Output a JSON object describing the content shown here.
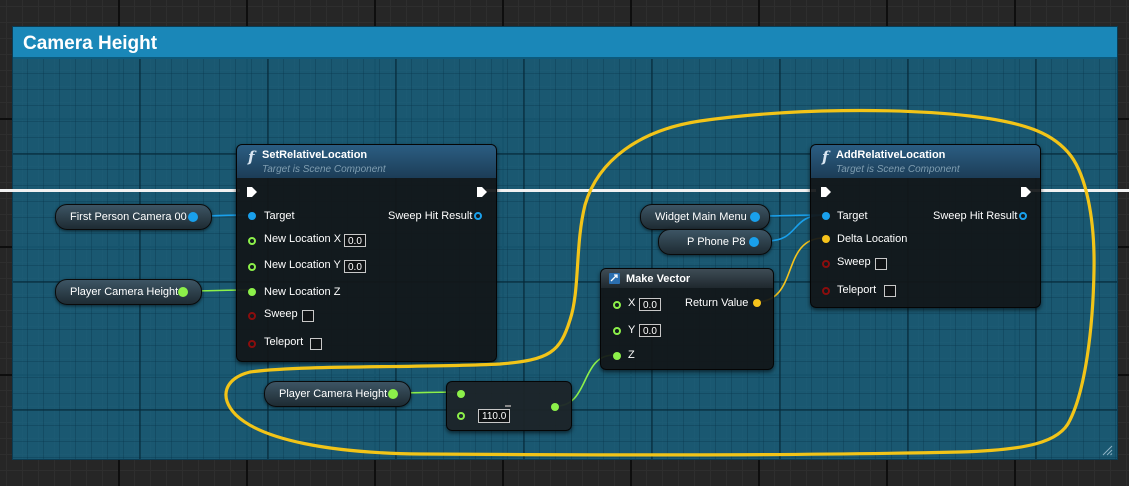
{
  "comment": {
    "title": "Camera Height"
  },
  "set_node": {
    "title": "SetRelativeLocation",
    "subtitle": "Target is Scene Component",
    "pins": {
      "target": "Target",
      "new_x": "New Location X",
      "new_y": "New Location Y",
      "new_z": "New Location Z",
      "sweep": "Sweep",
      "teleport": "Teleport",
      "sweep_hit": "Sweep Hit Result"
    },
    "values": {
      "x": "0.0",
      "y": "0.0"
    }
  },
  "add_node": {
    "title": "AddRelativeLocation",
    "subtitle": "Target is Scene Component",
    "pins": {
      "target": "Target",
      "delta": "Delta Location",
      "sweep": "Sweep",
      "teleport": "Teleport",
      "sweep_hit": "Sweep Hit Result"
    }
  },
  "make_vector": {
    "title": "Make Vector",
    "pins": {
      "x": "X",
      "y": "Y",
      "z": "Z",
      "return": "Return Value"
    },
    "values": {
      "x": "0.0",
      "y": "0.0"
    }
  },
  "variables": {
    "first_person_camera": "First Person Camera 00",
    "player_camera_height_1": "Player Camera Height",
    "player_camera_height_2": "Player Camera Height",
    "widget_main_menu": "Widget Main Menu",
    "p_phone": "P Phone P8"
  },
  "add_float": {
    "value": "110.0"
  },
  "colors": {
    "object_pin": "#19a0ec",
    "float_pin": "#8cf04a",
    "vector_pin": "#f6c31b",
    "bool_pin": "#8a0d0d",
    "exec_wire": "#f2f2f2",
    "annotation": "#f2c418",
    "comment_header": "#1a87b8"
  },
  "icons": [
    "function-icon",
    "make-vector-icon",
    "exec-pin-icon",
    "resize-grip-icon"
  ]
}
